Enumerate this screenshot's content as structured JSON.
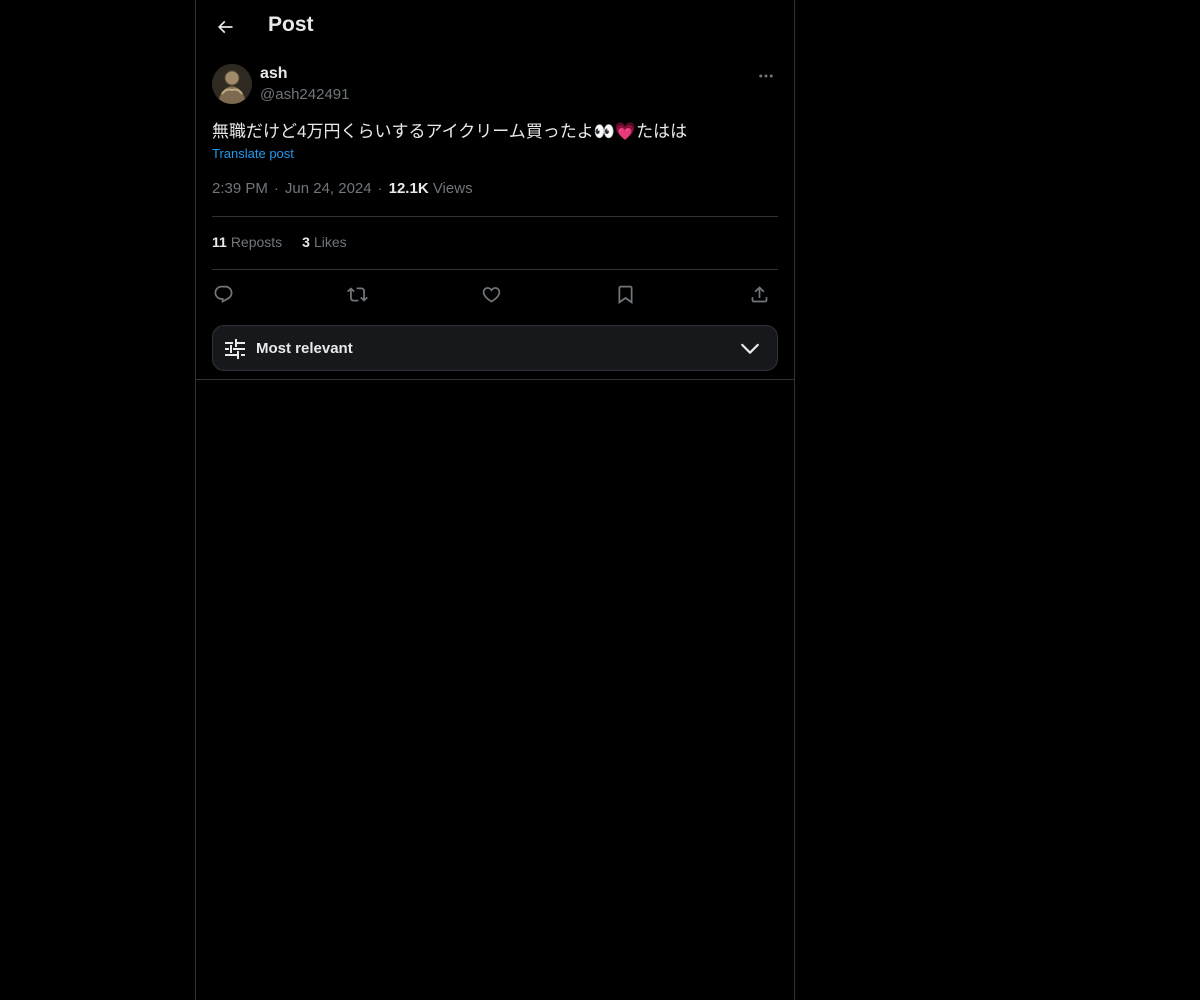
{
  "header": {
    "title": "Post",
    "back_icon": "arrow-left-icon"
  },
  "post": {
    "author": {
      "display_name": "ash",
      "handle": "@ash242491"
    },
    "text": "無職だけど4万円くらいするアイクリーム買ったよ👀💗たはは",
    "translate_label": "Translate post",
    "time": "2:39 PM",
    "date": "Jun 24, 2024",
    "views_count": "12.1K",
    "views_label": "Views",
    "separator": "·",
    "reposts_count": "11",
    "reposts_label": "Reposts",
    "likes_count": "3",
    "likes_label": "Likes"
  },
  "actions": [
    "reply-icon",
    "repost-icon",
    "like-icon",
    "bookmark-icon",
    "share-icon"
  ],
  "sort": {
    "label": "Most relevant"
  },
  "colors": {
    "background": "#000000",
    "text": "#e7e9ea",
    "muted": "#71767b",
    "link": "#1d9bf0",
    "border": "#2f3336"
  }
}
